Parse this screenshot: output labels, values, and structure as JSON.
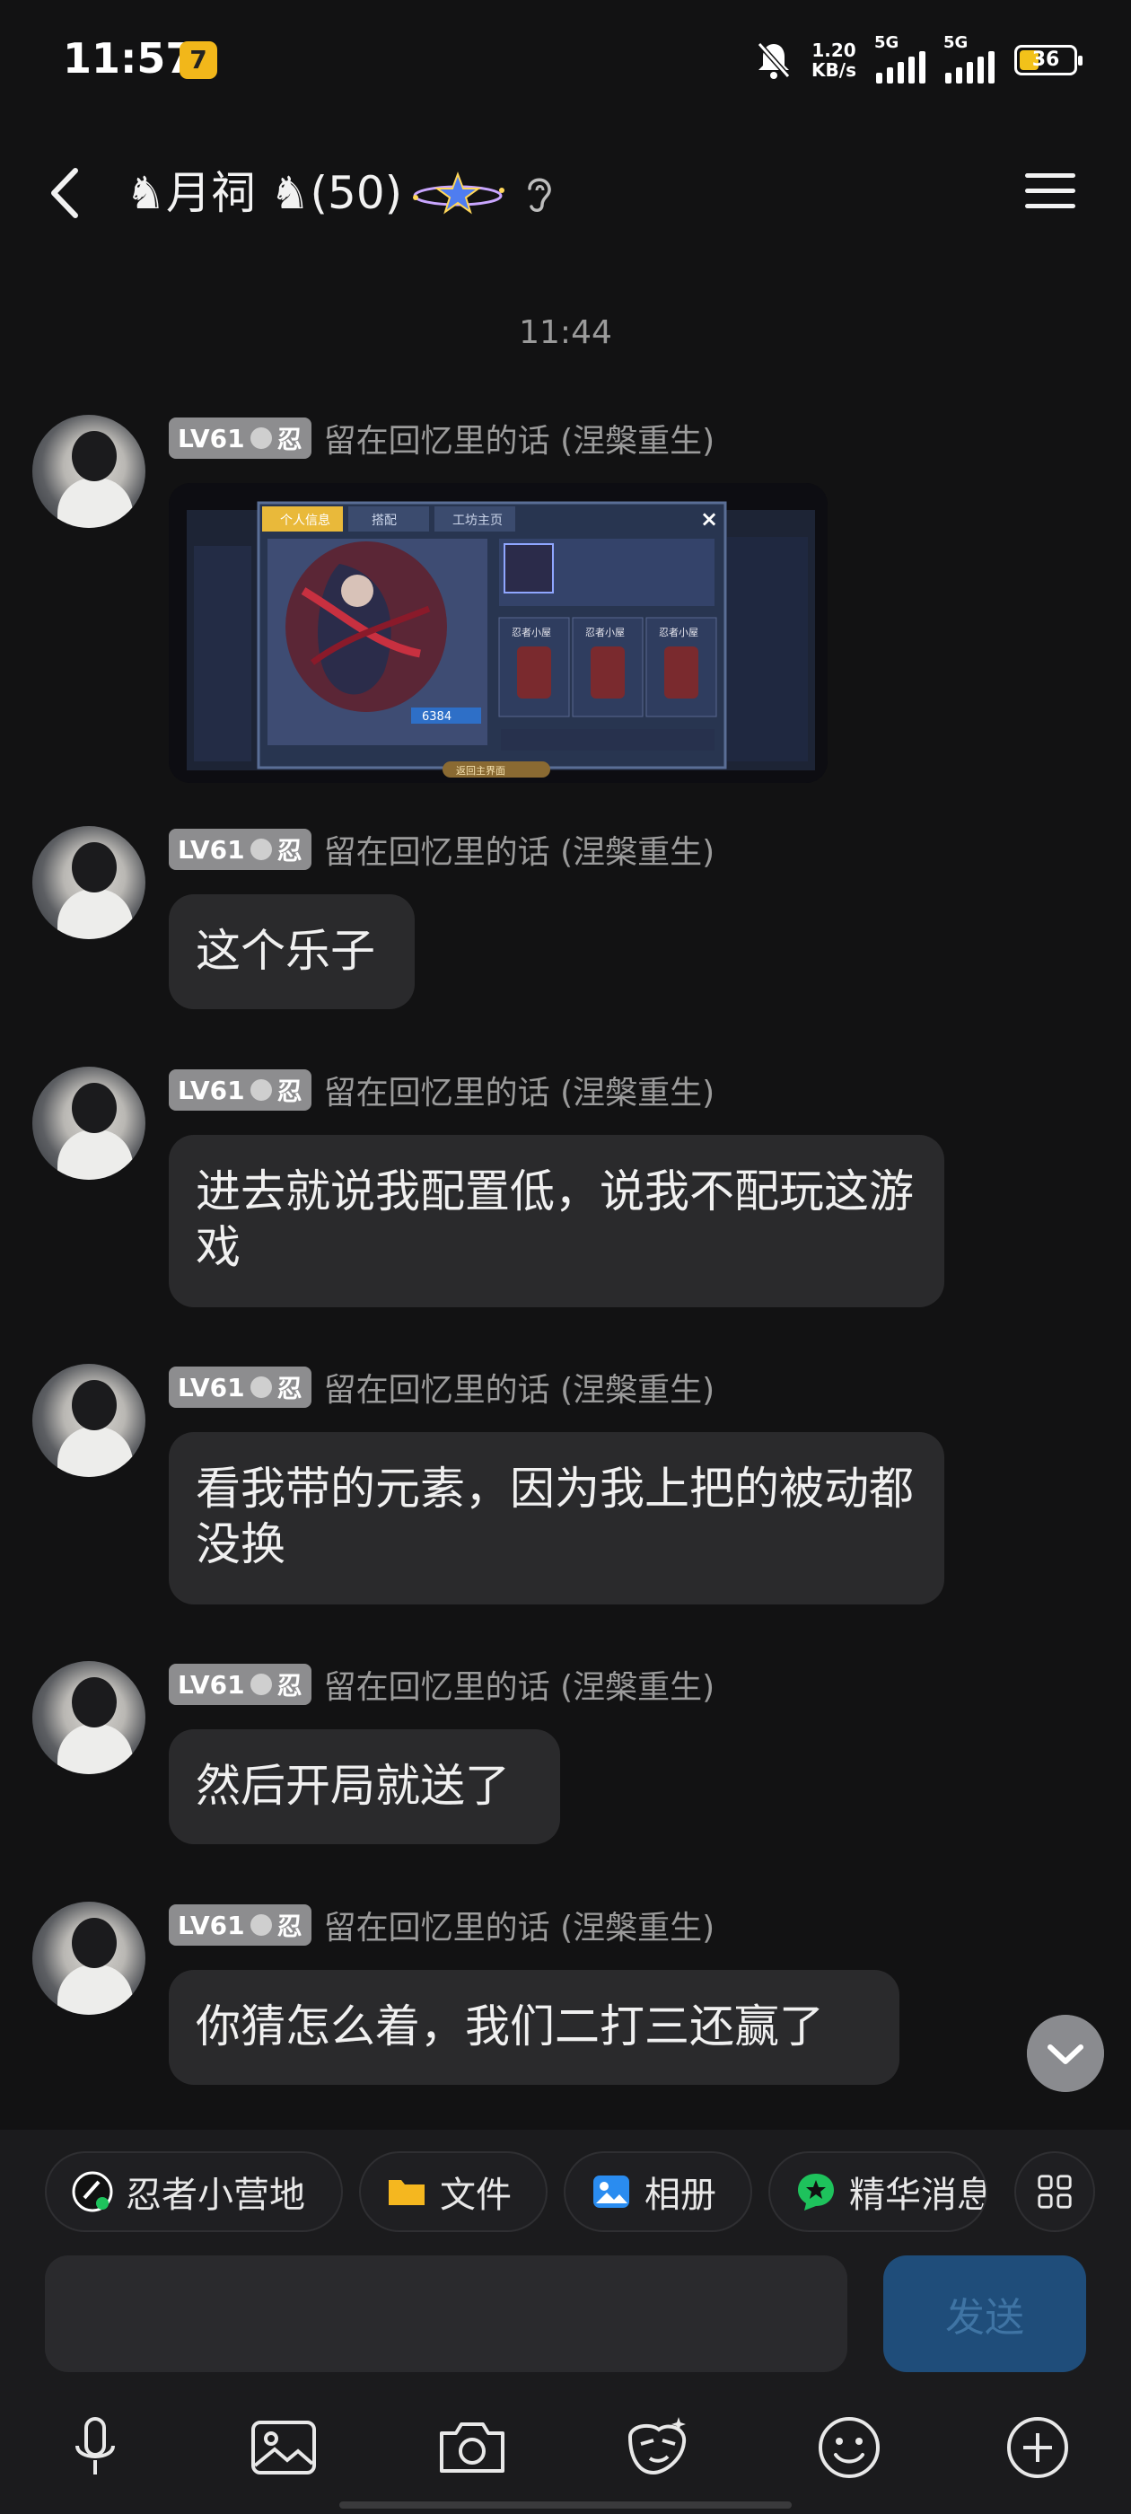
{
  "status_bar": {
    "time": "11:57",
    "app_badge": "7",
    "speed_value": "1.20",
    "speed_unit": "KB/s",
    "sim1": "5G",
    "sim2": "5G",
    "battery": "36",
    "battery_level_percent": 36,
    "battery_color": "#f2c21a"
  },
  "header": {
    "title": "♞月祠 ♞(50)",
    "back_icon": "chevron-left-icon",
    "menu_icon": "hamburger-menu-icon"
  },
  "chat": {
    "timestamp": "11:44",
    "messages": [
      {
        "level": "LV61",
        "rank_char": "忍",
        "nickname": "留在回忆里的话 (涅槃重生)",
        "type": "image"
      },
      {
        "level": "LV61",
        "rank_char": "忍",
        "nickname": "留在回忆里的话 (涅槃重生)",
        "type": "text",
        "text": "这个乐子"
      },
      {
        "level": "LV61",
        "rank_char": "忍",
        "nickname": "留在回忆里的话 (涅槃重生)",
        "type": "text",
        "text": "进去就说我配置低，说我不配玩这游戏"
      },
      {
        "level": "LV61",
        "rank_char": "忍",
        "nickname": "留在回忆里的话 (涅槃重生)",
        "type": "text",
        "text": "看我带的元素，因为我上把的被动都没换"
      },
      {
        "level": "LV61",
        "rank_char": "忍",
        "nickname": "留在回忆里的话 (涅槃重生)",
        "type": "text",
        "text": "然后开局就送了"
      },
      {
        "level": "LV61",
        "rank_char": "忍",
        "nickname": "留在回忆里的话 (涅槃重生)",
        "type": "text",
        "text": "你猜怎么着，我们二打三还赢了"
      }
    ],
    "screenshot_overlay": {
      "tab1": "个人信息",
      "tab2": "搭配",
      "tab3": "工坊主页",
      "power": "6384",
      "card_label": "忍者小屋",
      "return_label": "返回主界面"
    }
  },
  "shortcuts": [
    {
      "label": "忍者小营地",
      "icon": "ninja-camp-icon"
    },
    {
      "label": "文件",
      "icon": "folder-icon"
    },
    {
      "label": "相册",
      "icon": "photo-album-icon"
    },
    {
      "label": "精华消息",
      "icon": "star-message-icon"
    }
  ],
  "composer": {
    "input_value": "",
    "send_label": "发送"
  },
  "toolbar": [
    "microphone-icon",
    "image-icon",
    "camera-icon",
    "sticker-icon",
    "emoji-icon",
    "plus-icon"
  ],
  "colors": {
    "background": "#121213",
    "bubble": "#2a2a2c",
    "send_button": "#1f4d7a",
    "folder": "#f5b71f",
    "album": "#2a8cf0",
    "essence": "#1ec25c"
  }
}
